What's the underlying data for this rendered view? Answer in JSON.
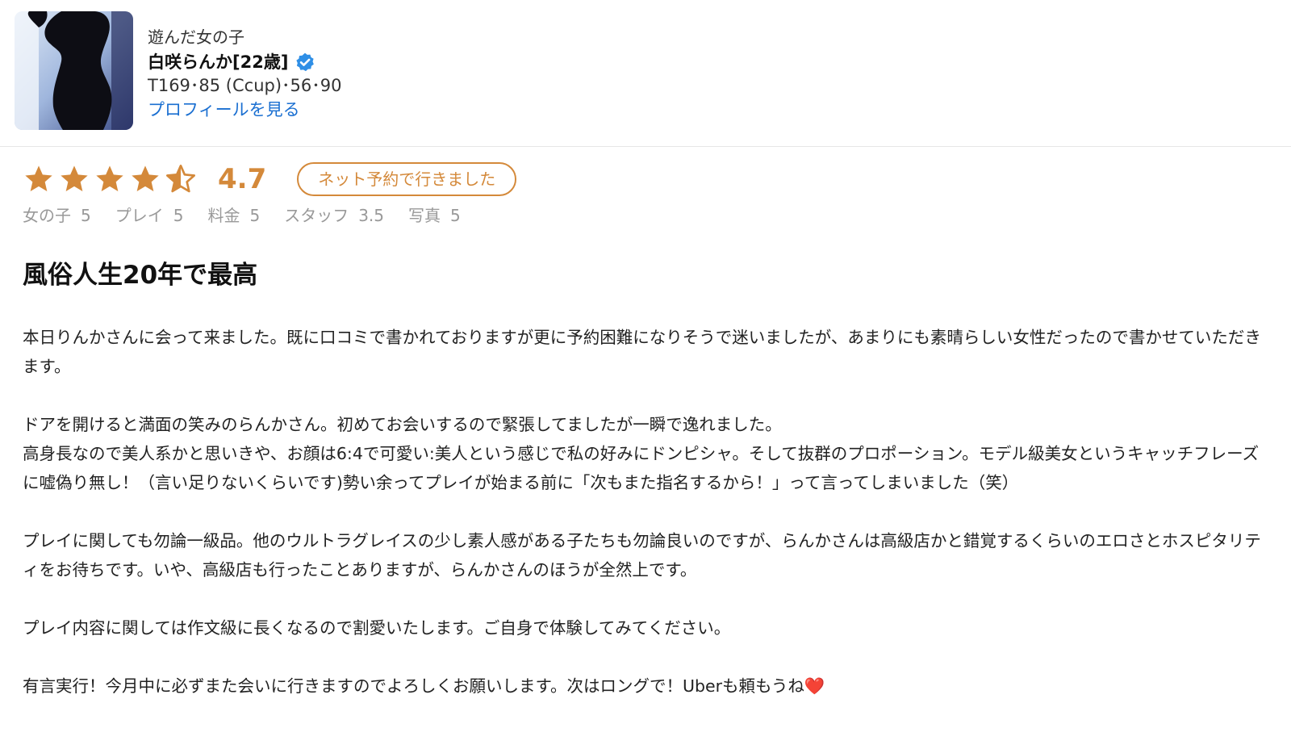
{
  "profile": {
    "label": "遊んだ女の子",
    "name": "白咲らんか[22歳]",
    "measurements": "T169･85 (Ccup)･56･90",
    "link_label": "プロフィールを見る"
  },
  "rating": {
    "score": "4.7",
    "stars_value": 4.5,
    "stars_max": 5,
    "badge": "ネット予約で行きました",
    "sub_ratings": [
      {
        "label": "女の子",
        "value": "5"
      },
      {
        "label": "プレイ",
        "value": "5"
      },
      {
        "label": "料金",
        "value": "5"
      },
      {
        "label": "スタッフ",
        "value": "3.5"
      },
      {
        "label": "写真",
        "value": "5"
      }
    ]
  },
  "review": {
    "title": "風俗人生20年で最高",
    "paragraphs": [
      "本日りんかさんに会って来ました。既に口コミで書かれておりますが更に予約困難になりそうで迷いましたが、あまりにも素晴らしい女性だったので書かせていただきます。",
      "ドアを開けると満面の笑みのらんかさん。初めてお会いするので緊張してましたが一瞬で逸れました。",
      "高身長なので美人系かと思いきや、お顔は6:4で可愛い:美人という感じで私の好みにドンピシャ。そして抜群のプロポーション。モデル級美女というキャッチフレーズに嘘偽り無し！（言い足りないくらいです)勢い余ってプレイが始まる前に「次もまた指名するから！」って言ってしまいました（笑）",
      "プレイに関しても勿論一級品。他のウルトラグレイスの少し素人感がある子たちも勿論良いのですが、らんかさんは高級店かと錯覚するくらいのエロさとホスピタリティをお待ちです。いや、高級店も行ったことありますが、らんかさんのほうが全然上です。",
      "プレイ内容に関しては作文級に長くなるので割愛いたします。ご自身で体験してみてください。",
      "有言実行！今月中に必ずまた会いに行きますのでよろしくお願いします。次はロングで！Uberも頼もうね"
    ],
    "trailing_emoji": "❤️"
  },
  "colors": {
    "accent": "#d4893a",
    "link": "#1a6fd1",
    "verified": "#2f8fe6"
  }
}
